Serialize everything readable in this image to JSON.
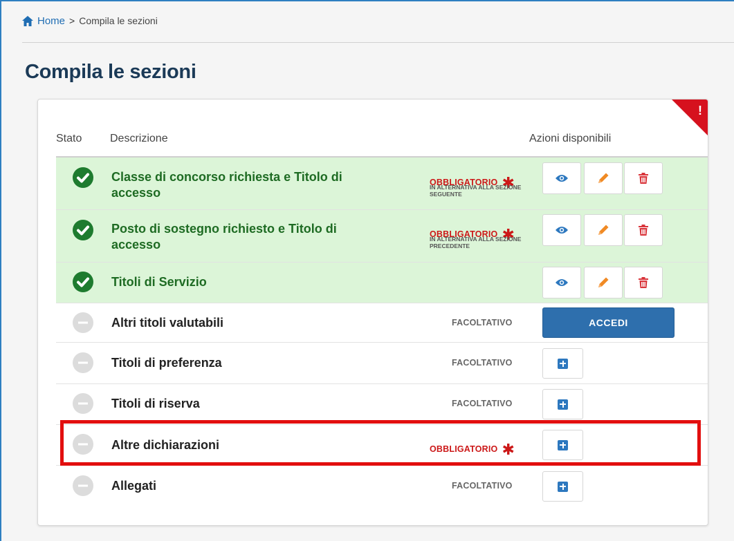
{
  "breadcrumb": {
    "home": "Home",
    "separator": ">",
    "current": "Compila le sezioni"
  },
  "page_title": "Compila le sezioni",
  "corner_flag": "!",
  "table": {
    "col_stato": "Stato",
    "col_descrizione": "Descrizione",
    "col_azioni": "Azioni disponibili"
  },
  "rows": [
    {
      "description": "Classe di concorso richiesta e Titolo di accesso",
      "state": "completed",
      "requirement": "OBBLIGATORIO",
      "note": "IN ALTERNATIVA ALLA SEZIONE SEGUENTE",
      "actions": [
        "view",
        "edit",
        "delete"
      ]
    },
    {
      "description": "Posto di sostegno richiesto e Titolo di accesso",
      "state": "completed",
      "requirement": "OBBLIGATORIO",
      "note": "IN ALTERNATIVA ALLA SEZIONE PRECEDENTE",
      "actions": [
        "view",
        "edit",
        "delete"
      ]
    },
    {
      "description": "Titoli di Servizio",
      "state": "completed",
      "requirement": "",
      "note": "",
      "actions": [
        "view",
        "edit",
        "delete"
      ]
    },
    {
      "description": "Altri titoli valutabili",
      "state": "pending",
      "requirement": "FACOLTATIVO",
      "note": "",
      "actions": [
        "accedi"
      ],
      "accedi_label": "ACCEDI"
    },
    {
      "description": "Titoli di preferenza",
      "state": "pending",
      "requirement": "FACOLTATIVO",
      "note": "",
      "actions": [
        "add"
      ]
    },
    {
      "description": "Titoli di riserva",
      "state": "pending",
      "requirement": "FACOLTATIVO",
      "note": "",
      "actions": [
        "add"
      ]
    },
    {
      "description": "Altre dichiarazioni",
      "state": "pending",
      "requirement": "OBBLIGATORIO",
      "note": "",
      "actions": [
        "add"
      ],
      "highlighted": true
    },
    {
      "description": "Allegati",
      "state": "pending",
      "requirement": "FACOLTATIVO",
      "note": "",
      "actions": [
        "add"
      ]
    }
  ],
  "required_star": "✱",
  "colors": {
    "completed_bg": "#dcf5d8",
    "completed_text": "#1e6b23",
    "required": "#cc1818",
    "primary": "#2e6fad",
    "highlight": "#e20f0f"
  }
}
